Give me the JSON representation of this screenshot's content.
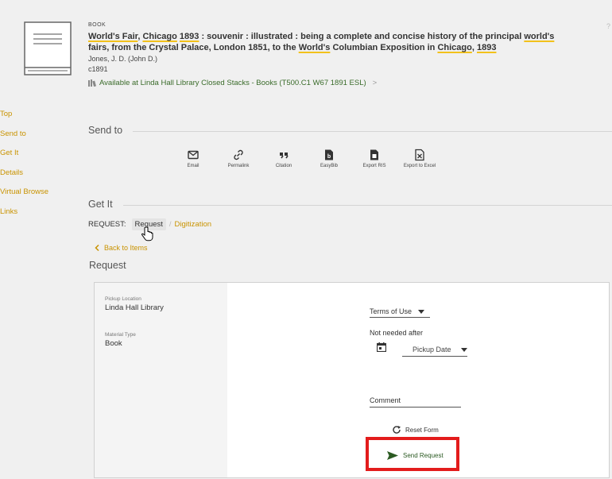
{
  "record": {
    "type": "BOOK",
    "title_parts": {
      "p1": "World's Fair",
      "p2": ", ",
      "p3": "Chicago",
      "p4": " ",
      "p5": "1893",
      "p6": " : souvenir : illustrated : being a complete and concise history of the principal ",
      "p7": "world's",
      "p8": " fairs, from the Crystal Palace, London 1851, to the ",
      "p9": "World's",
      "p10": " Columbian Exposition in ",
      "p11": "Chicago",
      "p12": ", ",
      "p13": "1893"
    },
    "author": "Jones, J. D. (John D.)",
    "date": "c1891",
    "availability": "Available at Linda Hall Library  Closed Stacks - Books (T500.C1 W67 1891 ESL)",
    "availability_chevron": ">",
    "corner_mark": "?"
  },
  "nav": {
    "items": [
      "Top",
      "Send to",
      "Get It",
      "Details",
      "Virtual Browse",
      "Links"
    ]
  },
  "send_to": {
    "title": "Send to",
    "actions": [
      {
        "label": "Email",
        "icon": "email-icon"
      },
      {
        "label": "Permalink",
        "icon": "link-icon"
      },
      {
        "label": "Citation",
        "icon": "quote-icon"
      },
      {
        "label": "EasyBib",
        "icon": "easybib-icon"
      },
      {
        "label": "Export RIS",
        "icon": "export-ris-icon"
      },
      {
        "label": "Export to Excel",
        "icon": "excel-icon"
      }
    ]
  },
  "get_it": {
    "title": "Get It",
    "request_label": "REQUEST:",
    "tab_request": "Request",
    "tab_digitization": "Digitization",
    "back_link": "Back to Items",
    "request_heading": "Request"
  },
  "form": {
    "pickup_location_label": "Pickup Location",
    "pickup_location_value": "Linda Hall Library",
    "material_type_label": "Material Type",
    "material_type_value": "Book",
    "terms_of_use": "Terms of Use",
    "not_needed_after": "Not needed after",
    "pickup_date_placeholder": "Pickup Date",
    "comment_placeholder": "Comment",
    "reset_label": "Reset Form",
    "send_label": "Send Request"
  },
  "colors": {
    "accent": "#c99300",
    "highlight": "#e31c1c",
    "underline": "#f2c11b"
  }
}
